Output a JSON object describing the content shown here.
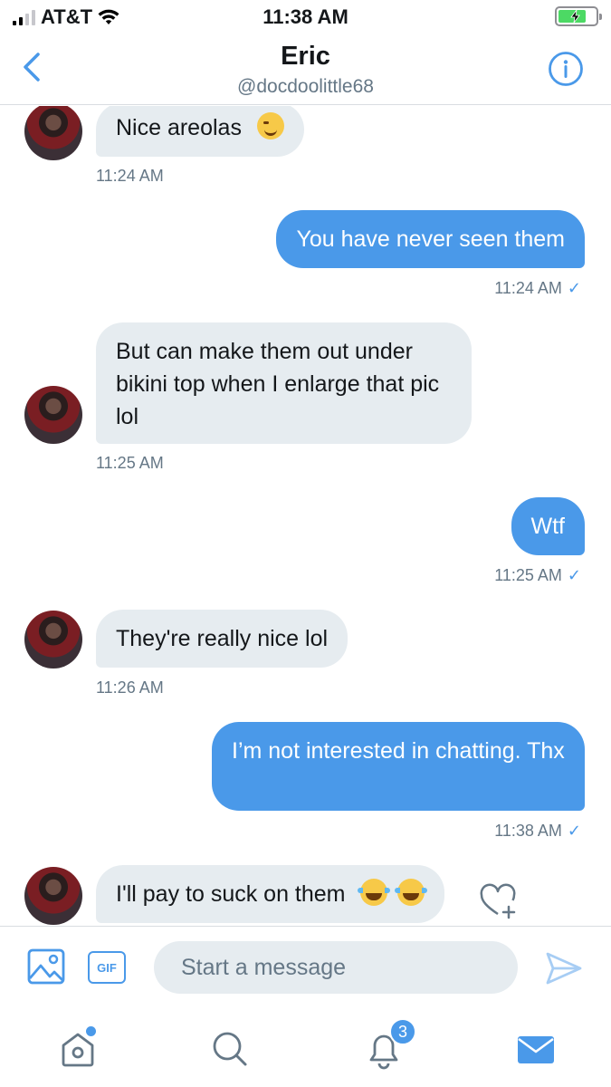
{
  "status_bar": {
    "carrier": "AT&T",
    "time": "11:38 AM"
  },
  "header": {
    "name": "Eric",
    "handle": "@docdoolittle68"
  },
  "messages": [
    {
      "direction": "in",
      "text": "Nice areolas",
      "emoji": "winking-face",
      "time": "11:24 AM"
    },
    {
      "direction": "out",
      "text": "You have never seen them",
      "time": "11:24 AM",
      "status": "✓"
    },
    {
      "direction": "in",
      "text": "But can make them out under bikini top when I enlarge that pic lol",
      "time": "11:25 AM"
    },
    {
      "direction": "out",
      "text": "Wtf",
      "time": "11:25 AM",
      "status": "✓"
    },
    {
      "direction": "in",
      "text": "They're really nice lol",
      "time": "11:26 AM"
    },
    {
      "direction": "out",
      "text": "I’m not interested in chatting. Thx",
      "time": "11:38 AM",
      "status": "✓"
    },
    {
      "direction": "in",
      "text": "I'll pay to suck on them",
      "emoji": "tears-of-joy x2"
    }
  ],
  "composer": {
    "gif_label": "GIF",
    "placeholder": "Start a message"
  },
  "tabbar": {
    "notifications_badge": "3"
  },
  "colors": {
    "accent": "#4a99e9",
    "incoming_bubble": "#e6ecf0",
    "secondary_text": "#657786"
  }
}
